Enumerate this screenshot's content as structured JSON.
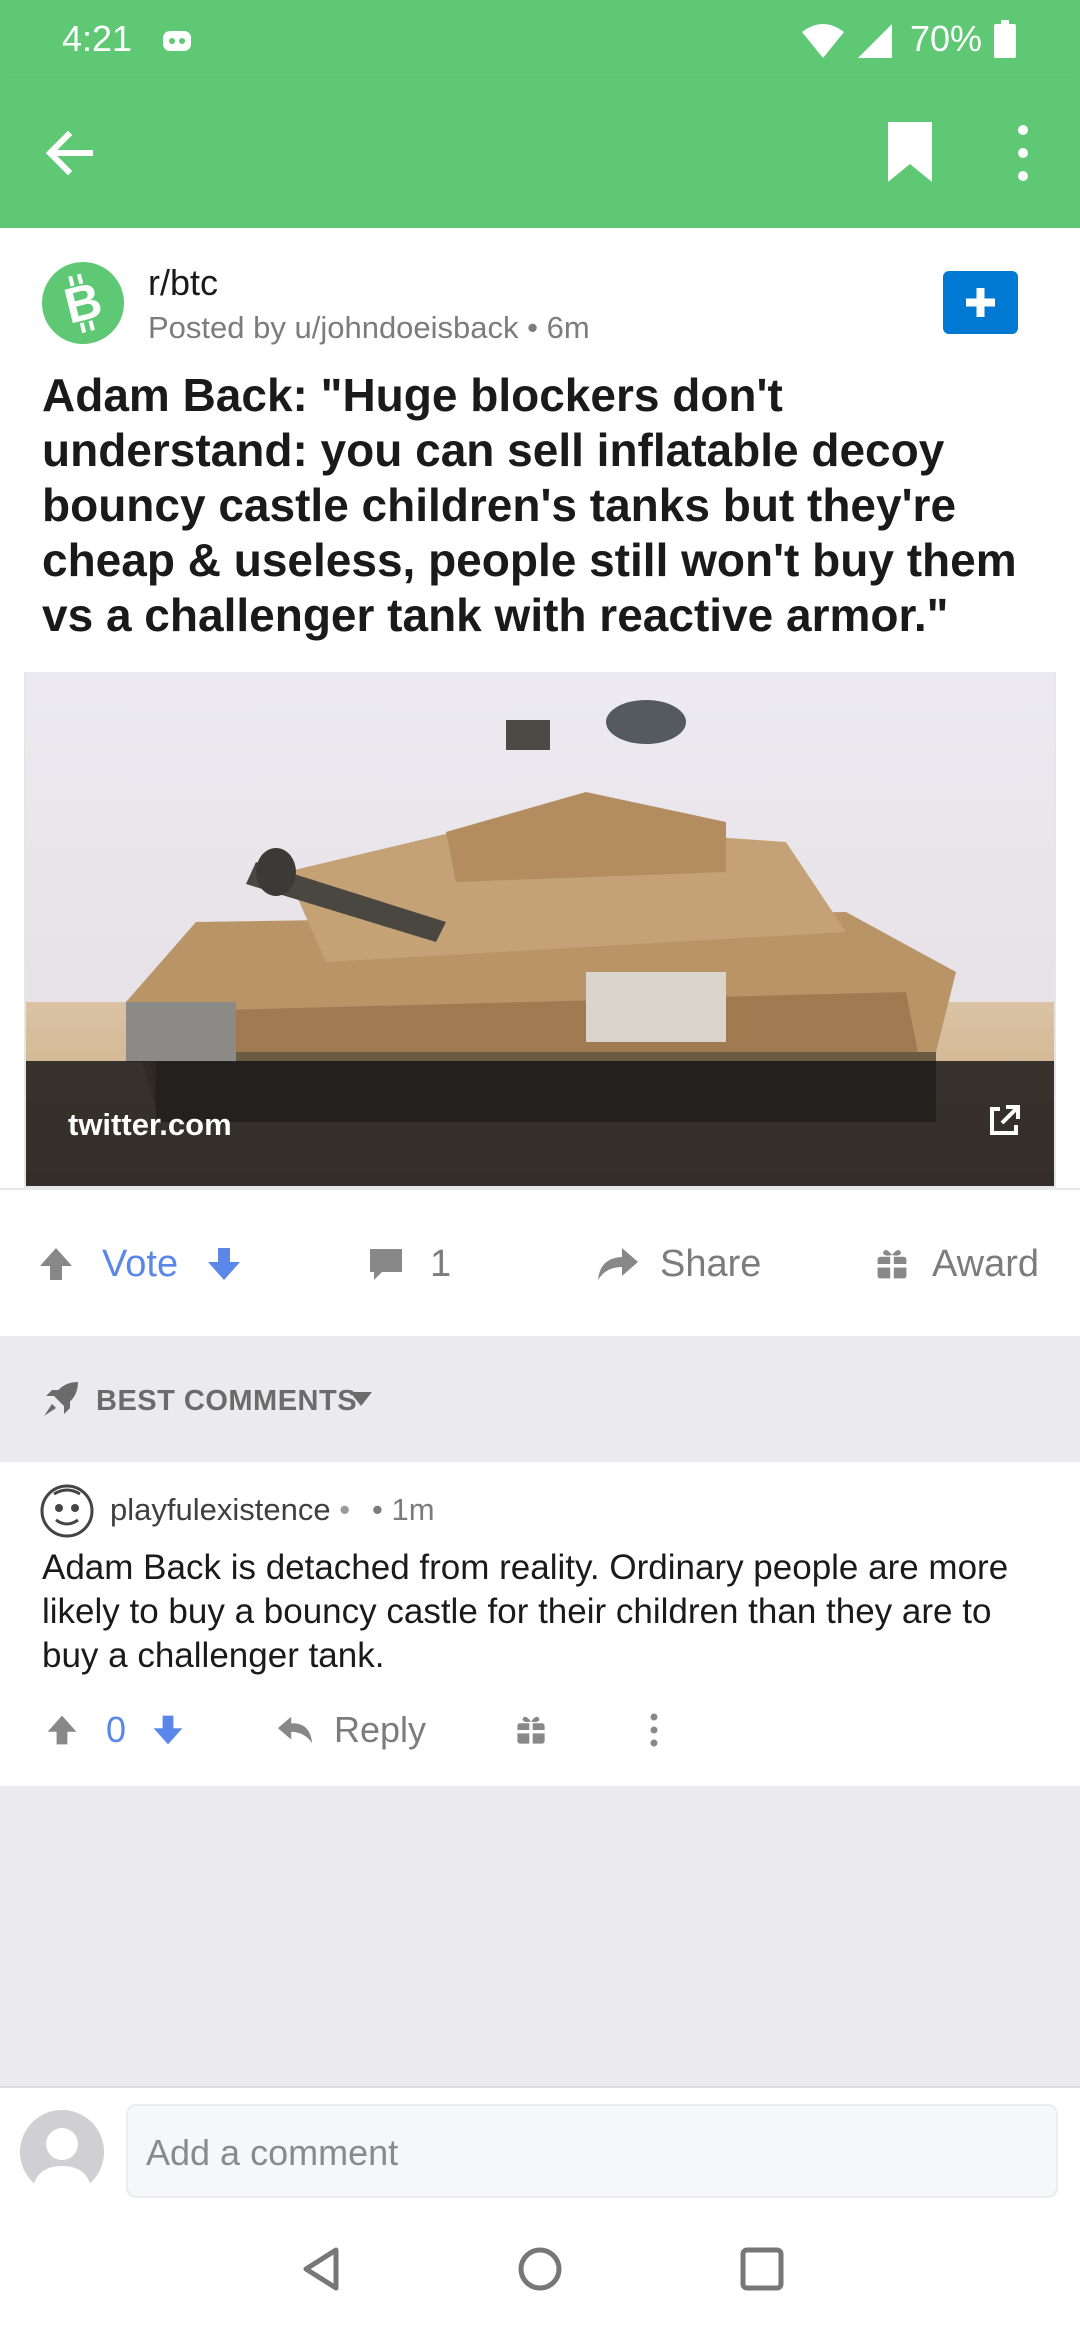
{
  "status_bar": {
    "time": "4:21",
    "battery": "70%",
    "icons": [
      "discord-icon",
      "wifi-icon",
      "signal-icon",
      "battery-icon"
    ]
  },
  "app_bar": {
    "icons": [
      "back-arrow-icon",
      "bookmark-icon",
      "more-vertical-icon"
    ],
    "color": "#5ec874"
  },
  "post": {
    "subreddit": "r/btc",
    "meta": "Posted by u/johndoeisback • 6m",
    "title": "Adam Back: \"Huge blockers don't understand: you can sell inflatable decoy bouncy castle children's tanks but they're cheap & useless, people still won't buy them vs a challenger tank with reactive armor.\"",
    "link_domain": "twitter.com",
    "image": "tank-photo"
  },
  "actions": {
    "vote_label": "Vote",
    "comment_count": "1",
    "share_label": "Share",
    "award_label": "Award"
  },
  "sort": {
    "label": "BEST COMMENTS"
  },
  "comments": [
    {
      "user": "playfulexistence",
      "separator": "•",
      "time": "• 1m",
      "body": "Adam Back is detached from reality. Ordinary people are more likely to buy a bouncy castle for their children than they are to buy a challenger tank.",
      "score": "0",
      "reply_label": "Reply"
    }
  ],
  "composer": {
    "placeholder": "Add a comment"
  },
  "colors": {
    "accent_green": "#5ec874",
    "vote_blue": "#5a87e8",
    "join_blue": "#0079d3"
  }
}
